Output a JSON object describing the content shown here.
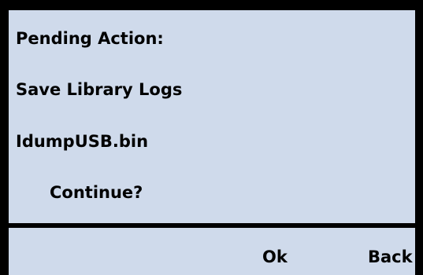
{
  "dialog": {
    "heading": "Pending Action:",
    "action": "Save Library Logs",
    "filename": "IdumpUSB.bin",
    "prompt": "Continue?"
  },
  "softkeys": {
    "ok_label": "Ok",
    "back_label": "Back"
  },
  "colors": {
    "screen_background": "#cfdaeb",
    "frame": "#000000",
    "text": "#000000"
  }
}
